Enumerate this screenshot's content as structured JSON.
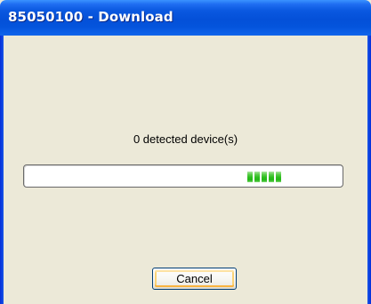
{
  "window": {
    "title": "85050100 - Download"
  },
  "status": {
    "text": "0 detected device(s)"
  },
  "progress": {
    "style": "marquee",
    "block_count": 5,
    "color": "#2bbd1c"
  },
  "buttons": {
    "cancel_label": "Cancel"
  },
  "colors": {
    "titlebar": "#0450d8",
    "dialog_background": "#ece9d8"
  }
}
